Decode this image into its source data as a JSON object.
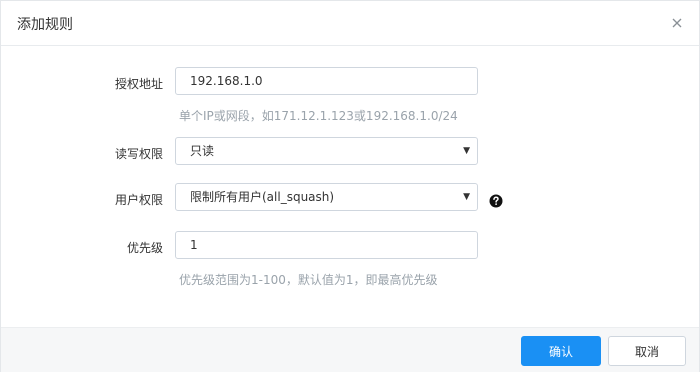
{
  "dialog": {
    "title": "添加规则"
  },
  "form": {
    "ip": {
      "label": "授权地址",
      "value": "192.168.1.0",
      "hint": "单个IP或网段，如171.12.1.123或192.168.1.0/24"
    },
    "rw": {
      "label": "读写权限",
      "selected": "只读"
    },
    "user": {
      "label": "用户权限",
      "selected": "限制所有用户(all_squash)"
    },
    "priority": {
      "label": "优先级",
      "value": "1",
      "hint": "优先级范围为1-100，默认值为1，即最高优先级"
    }
  },
  "footer": {
    "confirm_label": "确认",
    "cancel_label": "取消"
  },
  "icons": {
    "close": "close-icon",
    "help": "question-circle-icon",
    "dropdown": "chevron-down-icon"
  },
  "colors": {
    "primary": "#1a90f4",
    "hint_text": "#9aa3ab",
    "border": "#cfd6de"
  }
}
